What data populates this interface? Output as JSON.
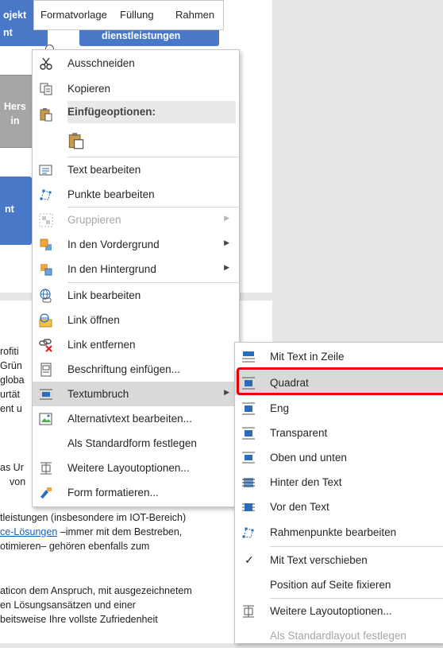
{
  "mini_toolbar": {
    "items": [
      "Formatvorlage",
      "Füllung",
      "Rahmen"
    ]
  },
  "shapes": {
    "top_left": "ojekt\nnt",
    "top_center": "dienstleistungen",
    "middle_grey": "Hers\nin",
    "lower_left": "nt"
  },
  "document_lines": [
    "rofiti",
    "Grün",
    "globa",
    "urtät",
    "ent u",
    "as Ur",
    "von",
    "tleistungen (insbesondere im IOT-Bereich)",
    "ce-Lösungen",
    " –immer mit dem Bestreben,",
    "otimieren– gehören ebenfalls zum",
    "aticon dem Anspruch, mit ausgezeichnetem",
    "en Lösungsansätzen und einer",
    "beitsweise Ihre vollste Zufriedenheit"
  ],
  "context_menu": {
    "items": [
      {
        "label": "Ausschneiden",
        "icon": "scissors-icon"
      },
      {
        "label": "Kopieren",
        "icon": "copy-icon"
      },
      {
        "label": "Einfügeoptionen:",
        "icon": "paste-icon"
      },
      {
        "label": "",
        "icon": "paste-keep-icon"
      },
      {
        "label": "Text bearbeiten",
        "icon": "edit-text-icon"
      },
      {
        "label": "Punkte bearbeiten",
        "icon": "edit-points-icon"
      },
      {
        "label": "Gruppieren",
        "icon": "group-icon",
        "disabled": true
      },
      {
        "label": "In den Vordergrund",
        "icon": "bring-forward-icon"
      },
      {
        "label": "In den Hintergrund",
        "icon": "send-backward-icon"
      },
      {
        "label": "Link bearbeiten",
        "icon": "link-edit-icon"
      },
      {
        "label": "Link öffnen",
        "icon": "link-open-icon"
      },
      {
        "label": "Link entfernen",
        "icon": "link-remove-icon"
      },
      {
        "label": "Beschriftung einfügen...",
        "icon": "caption-icon"
      },
      {
        "label": "Textumbruch",
        "icon": "wrap-text-icon",
        "highlighted": true
      },
      {
        "label": "Alternativtext bearbeiten...",
        "icon": "alt-text-icon"
      },
      {
        "label": "Als Standardform festlegen",
        "icon": ""
      },
      {
        "label": "Weitere Layoutoptionen...",
        "icon": "layout-options-icon"
      },
      {
        "label": "Form formatieren...",
        "icon": "format-shape-icon"
      }
    ]
  },
  "submenu": {
    "items": [
      {
        "label": "Mit Text in Zeile",
        "icon": "wrap-inline-icon"
      },
      {
        "label": "Quadrat",
        "icon": "wrap-square-icon",
        "highlighted": true
      },
      {
        "label": "Eng",
        "icon": "wrap-tight-icon"
      },
      {
        "label": "Transparent",
        "icon": "wrap-through-icon"
      },
      {
        "label": "Oben und unten",
        "icon": "wrap-top-bottom-icon"
      },
      {
        "label": "Hinter den Text",
        "icon": "behind-text-icon"
      },
      {
        "label": "Vor den Text",
        "icon": "in-front-text-icon"
      },
      {
        "label": "Rahmenpunkte bearbeiten",
        "icon": "edit-wrap-points-icon"
      },
      {
        "label": "Mit Text verschieben",
        "icon": "checkmark-icon",
        "checked": true
      },
      {
        "label": "Position auf Seite fixieren",
        "icon": ""
      },
      {
        "label": "Weitere Layoutoptionen...",
        "icon": "layout-options-icon"
      },
      {
        "label": "Als Standardlayout festlegen",
        "icon": "",
        "disabled": true
      }
    ]
  },
  "colors": {
    "shape_blue": "#4a78c8",
    "highlight": "#d9d9d9",
    "selection_box": "#e5000a",
    "link": "#1a5fb4"
  }
}
